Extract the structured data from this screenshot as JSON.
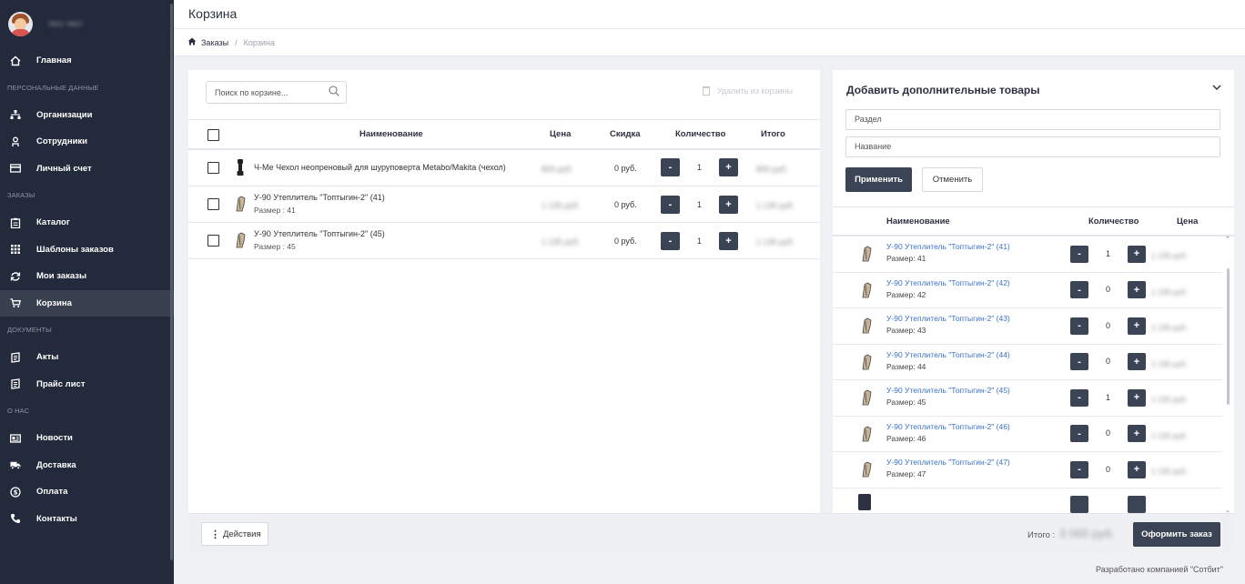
{
  "sidebar": {
    "username": "тест тест",
    "sections": {
      "personal": "Персональные данные",
      "orders": "Заказы",
      "documents": "Документы",
      "about": "О нас"
    },
    "items": {
      "home": "Главная",
      "orgs": "Организации",
      "employees": "Сотрудники",
      "account": "Личный счет",
      "catalog": "Каталог",
      "templates": "Шаблоны заказов",
      "my_orders": "Мои заказы",
      "cart": "Корзина",
      "acts": "Акты",
      "pricelist": "Прайс лист",
      "news": "Новости",
      "delivery": "Доставка",
      "payment": "Оплата",
      "contacts": "Контакты"
    }
  },
  "header": {
    "title": "Корзина"
  },
  "breadcrumb": {
    "link": "Заказы",
    "separator": "/",
    "current": "Корзина"
  },
  "cart": {
    "search_placeholder": "Поиск по корзине...",
    "delete_label": "Удалить из корзины",
    "columns": {
      "name": "Наименование",
      "price": "Цена",
      "discount": "Скидка",
      "qty": "Количество",
      "total": "Итого"
    },
    "rows": [
      {
        "name": "Ч-Ме Чехол неопреновый для шуруповерта Metabo/Makita (чехол)",
        "size": "",
        "price": "800 руб.",
        "discount": "0 руб.",
        "qty": "1",
        "total": "800 руб."
      },
      {
        "name": "У-90 Утеплитель \"Топтыгин-2\" (41)",
        "size": "Размер : 41",
        "price": "1 135 руб.",
        "discount": "0 руб.",
        "qty": "1",
        "total": "1 135 руб."
      },
      {
        "name": "У-90 Утеплитель \"Топтыгин-2\" (45)",
        "size": "Размер : 45",
        "price": "1 135 руб.",
        "discount": "0 руб.",
        "qty": "1",
        "total": "1 135 руб."
      }
    ]
  },
  "footer": {
    "actions_label": "Действия",
    "total_label": "Итого :",
    "total_value": "3 065 руб.",
    "order_label": "Оформить заказ",
    "credit": "Разработано компанией \"Сотбит\""
  },
  "extra": {
    "title": "Добавить дополнительные товары",
    "section_placeholder": "Раздел",
    "name_placeholder": "Название",
    "apply_label": "Применить",
    "cancel_label": "Отменить",
    "columns": {
      "name": "Наименование",
      "qty": "Количество",
      "price": "Цена"
    },
    "rows": [
      {
        "name": "У-90 Утеплитель \"Топтыгин-2\" (41)",
        "size": "Размер: 41",
        "qty": "1",
        "price": "1 135 руб."
      },
      {
        "name": "У-90 Утеплитель \"Топтыгин-2\" (42)",
        "size": "Размер: 42",
        "qty": "0",
        "price": "1 135 руб."
      },
      {
        "name": "У-90 Утеплитель \"Топтыгин-2\" (43)",
        "size": "Размер: 43",
        "qty": "0",
        "price": "1 135 руб."
      },
      {
        "name": "У-90 Утеплитель \"Топтыгин-2\" (44)",
        "size": "Размер: 44",
        "qty": "0",
        "price": "1 135 руб."
      },
      {
        "name": "У-90 Утеплитель \"Топтыгин-2\" (45)",
        "size": "Размер: 45",
        "qty": "1",
        "price": "1 135 руб."
      },
      {
        "name": "У-90 Утеплитель \"Топтыгин-2\" (46)",
        "size": "Размер: 46",
        "qty": "0",
        "price": "1 135 руб."
      },
      {
        "name": "У-90 Утеплитель \"Топтыгин-2\" (47)",
        "size": "Размер: 47",
        "qty": "0",
        "price": "1 135 руб."
      }
    ]
  },
  "colors": {
    "sidebar": "#232a3b",
    "accent": "#3b4455",
    "link": "#3b73c4"
  }
}
